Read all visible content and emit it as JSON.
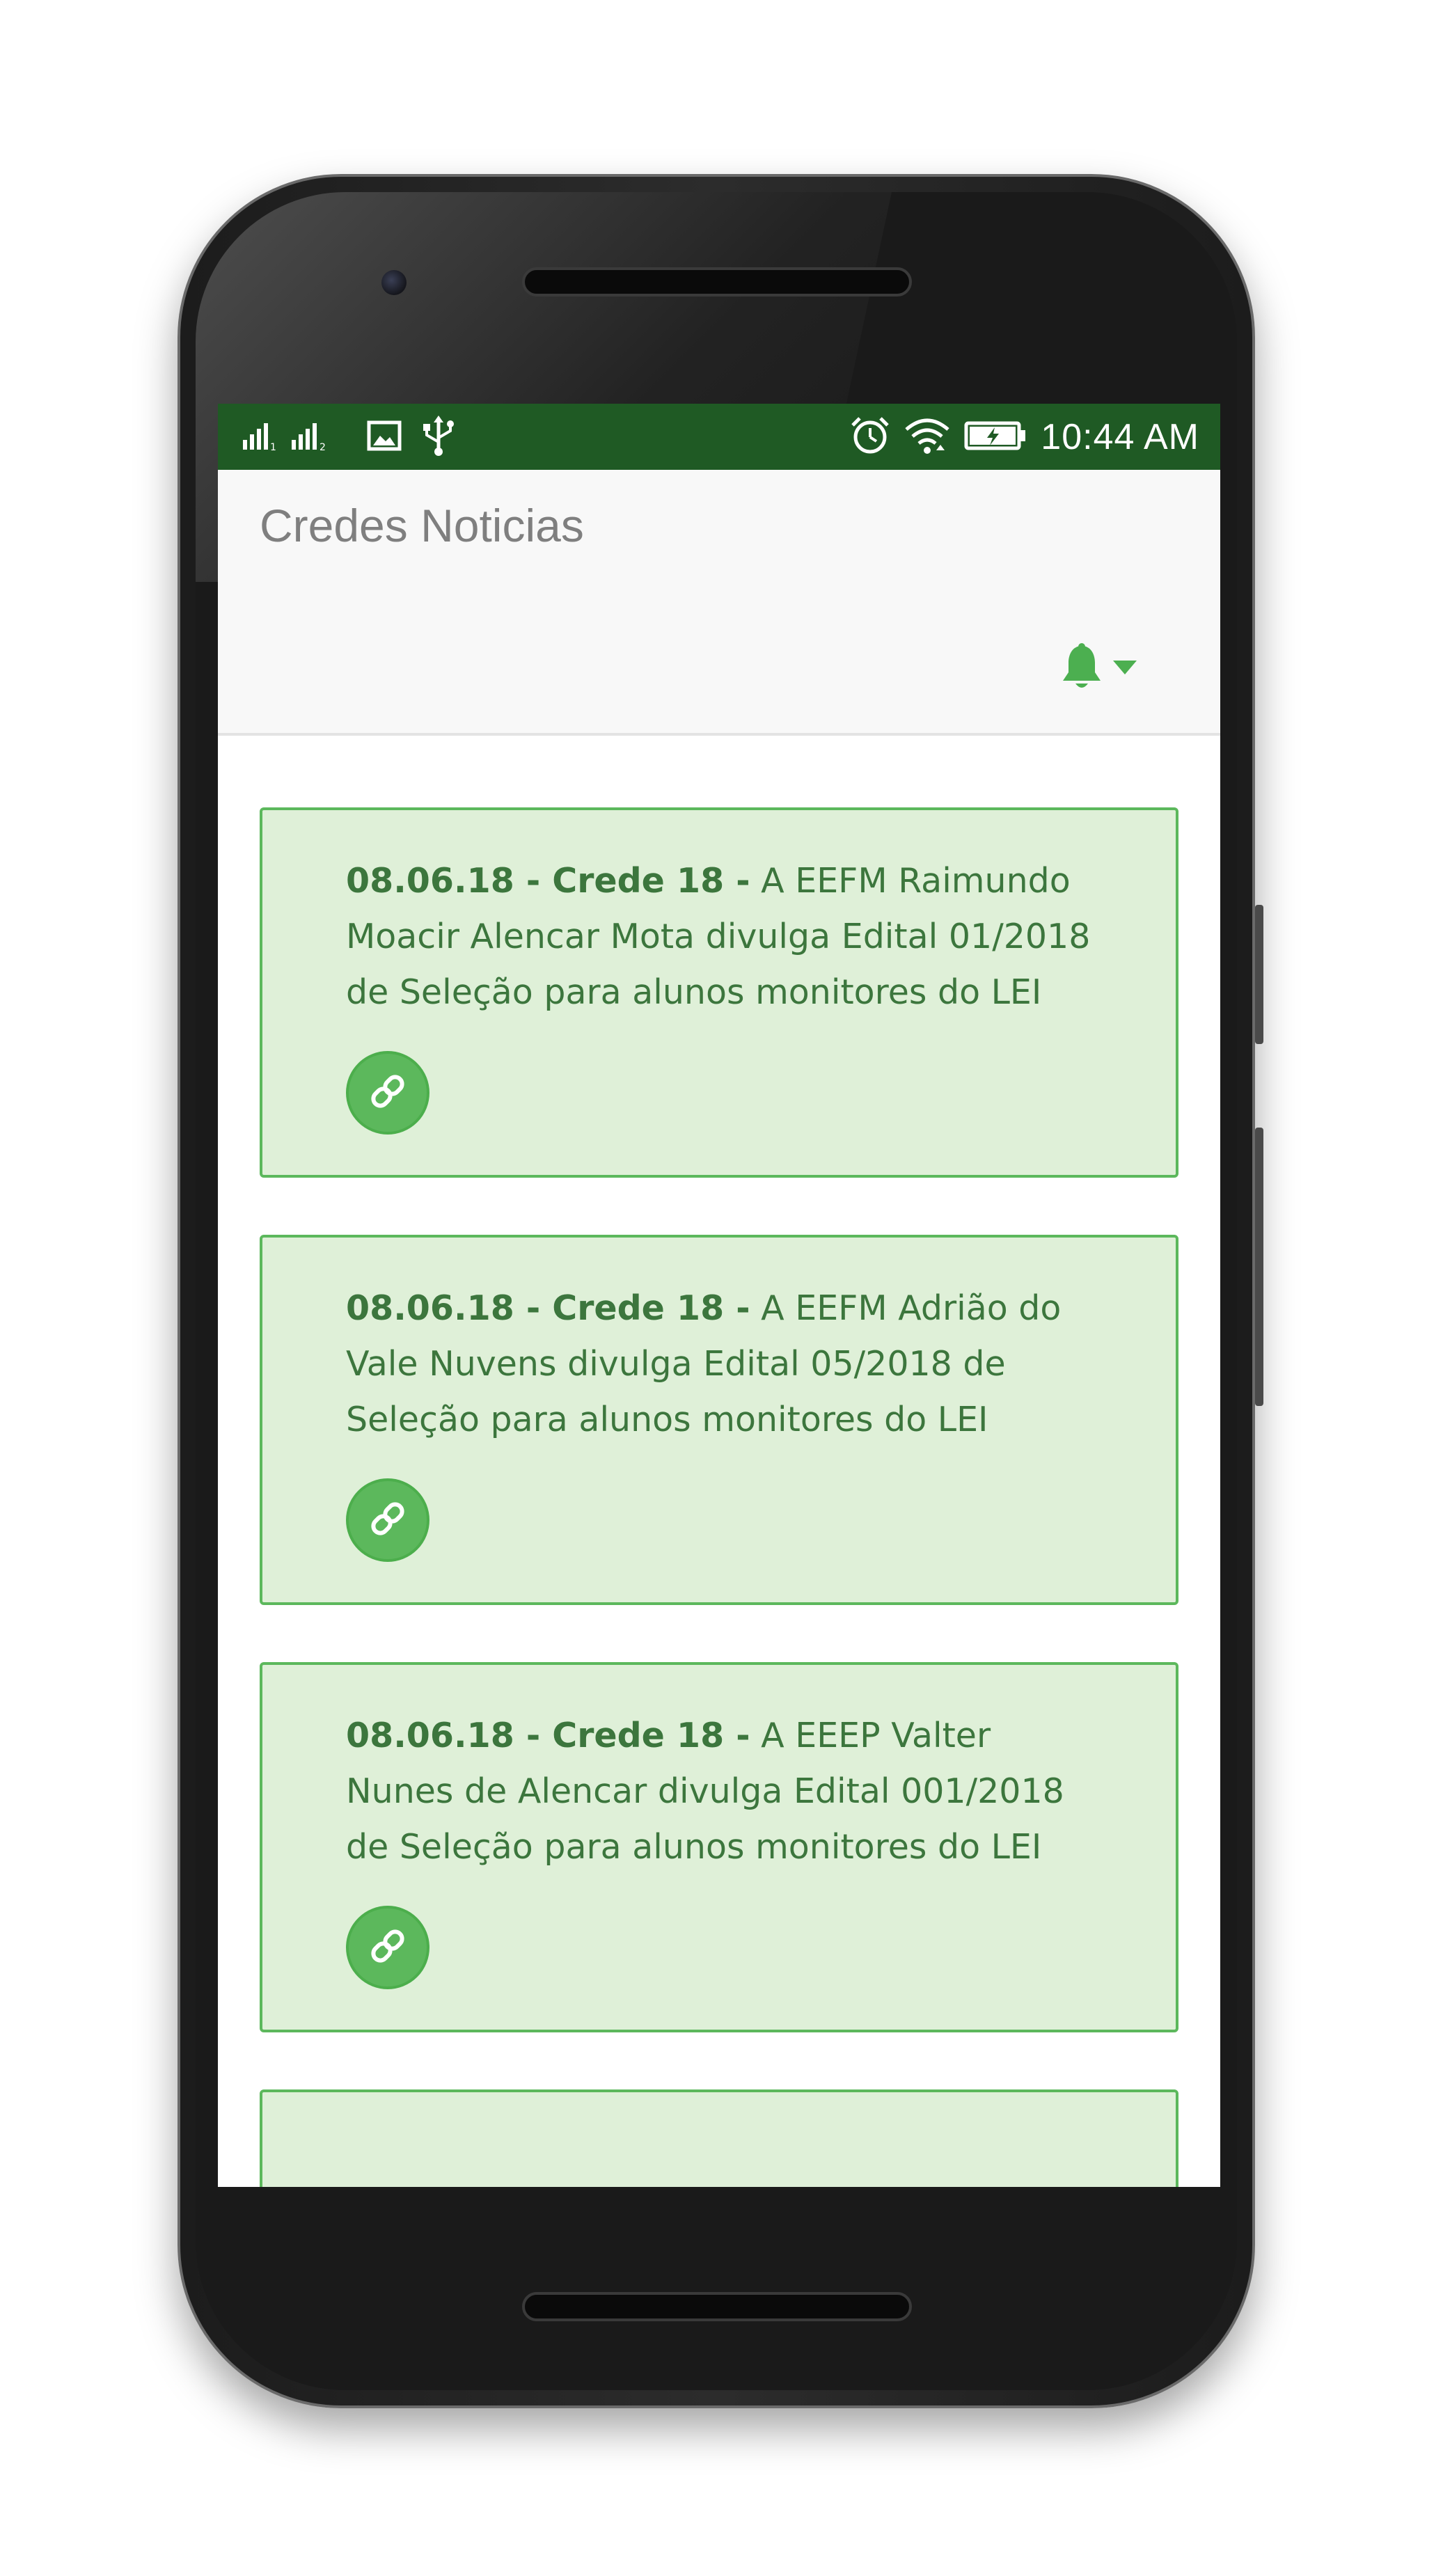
{
  "status_bar": {
    "time": "10:44 AM",
    "signal_label_1": "1",
    "signal_label_2": "2",
    "icons": [
      "signal-icon",
      "image-icon",
      "usb-icon",
      "alarm-icon",
      "wifi-icon",
      "battery-charging-icon"
    ]
  },
  "header": {
    "title": "Credes Noticias",
    "notification_icon": "bell-icon",
    "dropdown_icon": "caret-down-icon"
  },
  "news": [
    {
      "prefix": "08.06.18 - Crede 18 -",
      "text": "A EEFM Raimundo Moacir Alencar Mota divulga Edital 01/2018 de Seleção para alunos monitores do LEI",
      "link_icon": "link-icon"
    },
    {
      "prefix": "08.06.18 - Crede 18 -",
      "text": "A EEFM Adrião do Vale Nuvens divulga Edital 05/2018 de Seleção para alunos monitores do LEI",
      "link_icon": "link-icon"
    },
    {
      "prefix": "08.06.18 - Crede 18 -",
      "text": "A EEEP Valter Nunes de Alencar divulga Edital 001/2018 de Seleção para alunos monitores do LEI",
      "link_icon": "link-icon"
    }
  ],
  "colors": {
    "status_bar": "#1f5a24",
    "accent": "#5cb85c",
    "card_bg": "#dff0d8",
    "card_text": "#3c763d",
    "header_bg": "#f8f8f8"
  }
}
